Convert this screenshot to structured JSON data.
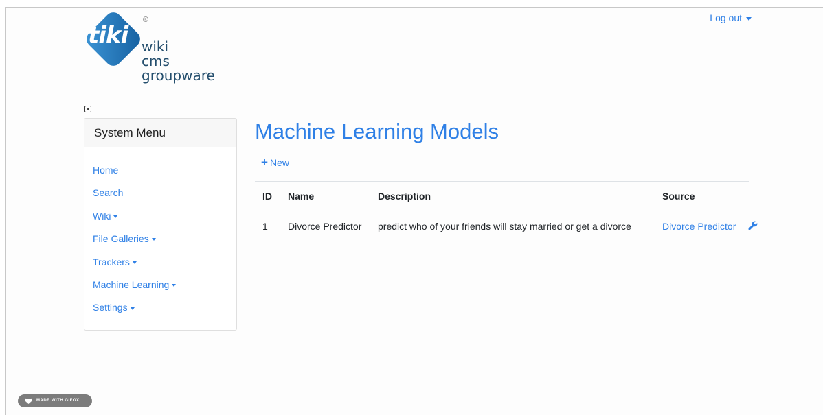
{
  "header": {
    "logo_wordmark": "tiki",
    "logo_lines": [
      "wiki",
      "cms",
      "groupware"
    ],
    "logout_label": "Log out"
  },
  "sidebar": {
    "title": "System Menu",
    "items": [
      {
        "label": "Home",
        "has_dropdown": false
      },
      {
        "label": "Search",
        "has_dropdown": false
      },
      {
        "label": "Wiki",
        "has_dropdown": true
      },
      {
        "label": "File Galleries",
        "has_dropdown": true
      },
      {
        "label": "Trackers",
        "has_dropdown": true
      },
      {
        "label": "Machine Learning",
        "has_dropdown": true
      },
      {
        "label": "Settings",
        "has_dropdown": true
      }
    ]
  },
  "main": {
    "title": "Machine Learning Models",
    "new_label": "New",
    "table": {
      "headers": [
        "ID",
        "Name",
        "Description",
        "Source"
      ],
      "rows": [
        {
          "id": "1",
          "name": "Divorce Predictor",
          "description": "predict who of your friends will stay married or get a divorce",
          "source": "Divorce Predictor"
        }
      ]
    }
  },
  "badge": {
    "label": "MADE WITH GIFOX"
  },
  "colors": {
    "accent": "#2f80e6",
    "logo_blue": "#1d70b8",
    "logo_text": "#244e6d"
  },
  "icons": [
    "tiki-logo",
    "caret-down-icon",
    "collapse-sidebar-icon",
    "plus-icon",
    "wrench-icon",
    "gifox-icon"
  ]
}
